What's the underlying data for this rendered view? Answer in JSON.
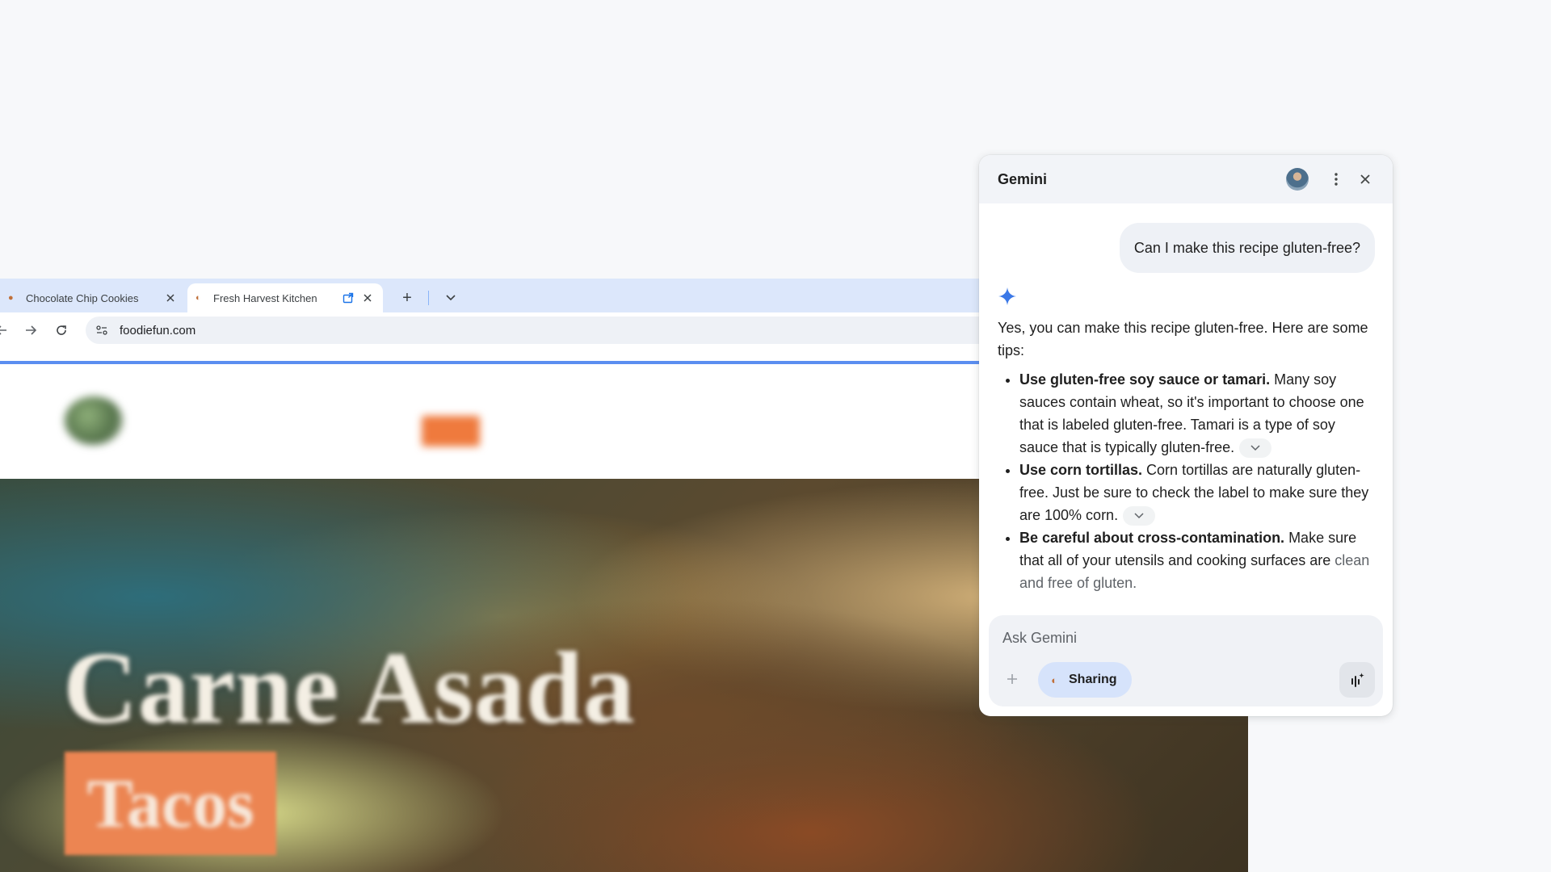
{
  "browser": {
    "tabs": [
      {
        "title": "Chocolate Chip Cookies",
        "active": false
      },
      {
        "title": "Fresh Harvest Kitchen",
        "active": true
      }
    ],
    "address": "foodiefun.com"
  },
  "page": {
    "hero_title": "Carne Asada",
    "hero_badge": "Tacos"
  },
  "gemini": {
    "title": "Gemini",
    "user_message": "Can I make this recipe gluten-free?",
    "intro": "Yes, you can make this recipe gluten-free. Here are some tips:",
    "tips": [
      {
        "bold": "Use gluten-free soy sauce or tamari.",
        "text": " Many soy sauces contain wheat, so it's important to choose one that is labeled gluten-free. Tamari is a type of soy sauce that is typically gluten-free."
      },
      {
        "bold": "Use corn tortillas.",
        "text": " Corn tortillas are naturally gluten-free. Just be sure to check the label to make sure they are 100% corn."
      },
      {
        "bold": "Be careful about cross-contamination.",
        "text": " Make sure that all of your utensils and cooking surfaces are ",
        "faded": "clean and free of gluten."
      }
    ],
    "input_placeholder": "Ask Gemini",
    "sharing_label": "Sharing"
  },
  "icons": {
    "accent": "#1a73e8",
    "spark_color": "#3b78e7",
    "chip_bg": "#d6e3fb"
  }
}
